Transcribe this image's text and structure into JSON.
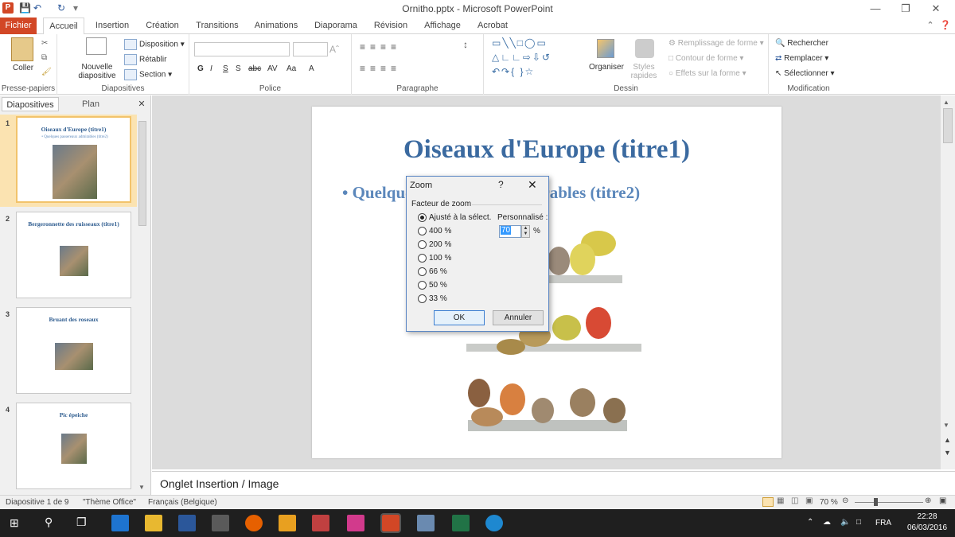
{
  "app": {
    "window_title": "Ornitho.pptx - Microsoft PowerPoint",
    "logo_letter": "P"
  },
  "tabs": [
    "Fichier",
    "Accueil",
    "Insertion",
    "Création",
    "Transitions",
    "Animations",
    "Diaporama",
    "Révision",
    "Affichage",
    "Acrobat"
  ],
  "ribbon": {
    "groups": [
      "Presse-papiers",
      "Diapositives",
      "Police",
      "Paragraphe",
      "Dessin",
      "Modification"
    ],
    "paste": "Coller",
    "new_slide": "Nouvelle diapositive",
    "layout": "Disposition",
    "reset": "Rétablir",
    "section": "Section",
    "font_buttons": [
      "G",
      "I",
      "S",
      "S",
      "abc",
      "AV",
      "Aa",
      "A"
    ],
    "arrange": "Organiser",
    "styles": "Styles rapides",
    "fill": "Remplissage de forme",
    "outline": "Contour de forme",
    "effects": "Effets sur la forme",
    "find": "Rechercher",
    "replace": "Remplacer",
    "select": "Sélectionner"
  },
  "leftpane": {
    "tab_slides": "Diapositives",
    "tab_outline": "Plan",
    "slides": [
      {
        "num": "1",
        "title": "Oiseaux d'Europe (titre1)",
        "subtitle": "• Quelques passereaux admirables (titre2)"
      },
      {
        "num": "2",
        "title": "Bergeronnette des ruisseaux (titre1)"
      },
      {
        "num": "3",
        "title": "Bruant des roseaux"
      },
      {
        "num": "4",
        "title": "Pic épeiche"
      }
    ]
  },
  "slide": {
    "title": "Oiseaux d'Europe (titre1)",
    "bullet": "• Quelques passereaux admirables (titre2)"
  },
  "notes": "Onglet Insertion / Image",
  "status": {
    "slide_of": "Diapositive 1 de 9",
    "theme": "\"Thème Office\"",
    "language": "Français (Belgique)",
    "zoom": "70 %"
  },
  "dialog": {
    "title": "Zoom",
    "help": "?",
    "close": "✕",
    "group_label": "Facteur de zoom",
    "options": [
      "Ajusté à la sélect.",
      "400 %",
      "200 %",
      "100 %",
      "66 %",
      "50 %",
      "33 %"
    ],
    "selected_index": 0,
    "custom_label": "Personnalisé :",
    "custom_value": "70",
    "percent": "%",
    "ok": "OK",
    "cancel": "Annuler"
  },
  "taskbar": {
    "lang": "FRA",
    "time": "22:28",
    "date": "06/03/2016"
  }
}
